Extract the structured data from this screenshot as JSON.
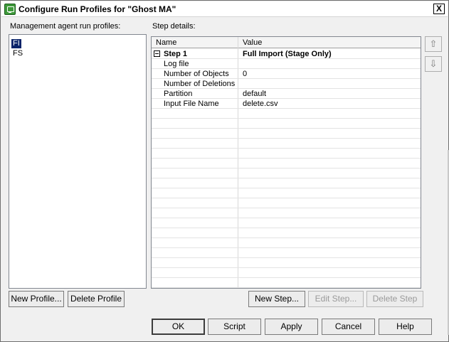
{
  "window": {
    "title": "Configure Run Profiles for \"Ghost MA\"",
    "close_glyph": "X"
  },
  "profiles": {
    "label": "Management agent run profiles:",
    "items": [
      "FI",
      "FS"
    ],
    "selected": "FI"
  },
  "steps": {
    "label": "Step details:",
    "columns": [
      "Name",
      "Value"
    ],
    "step": {
      "name": "Step 1",
      "value": "Full Import (Stage Only)"
    },
    "rows": [
      {
        "name": "Log file",
        "value": ""
      },
      {
        "name": "Number of Objects",
        "value": "0"
      },
      {
        "name": "Number of Deletions",
        "value": ""
      },
      {
        "name": "Partition",
        "value": "default"
      },
      {
        "name": "Input File Name",
        "value": "delete.csv"
      }
    ]
  },
  "reorder": {
    "up_icon": "arrow-up-icon",
    "down_icon": "arrow-down-icon",
    "up_glyph": "⇧",
    "down_glyph": "⇩"
  },
  "profile_buttons": {
    "new": "New Profile...",
    "delete": "Delete Profile"
  },
  "step_buttons": {
    "new": "New Step...",
    "edit": "Edit Step...",
    "delete": "Delete Step"
  },
  "footer_buttons": {
    "ok": "OK",
    "script": "Script",
    "apply": "Apply",
    "cancel": "Cancel",
    "help": "Help"
  }
}
